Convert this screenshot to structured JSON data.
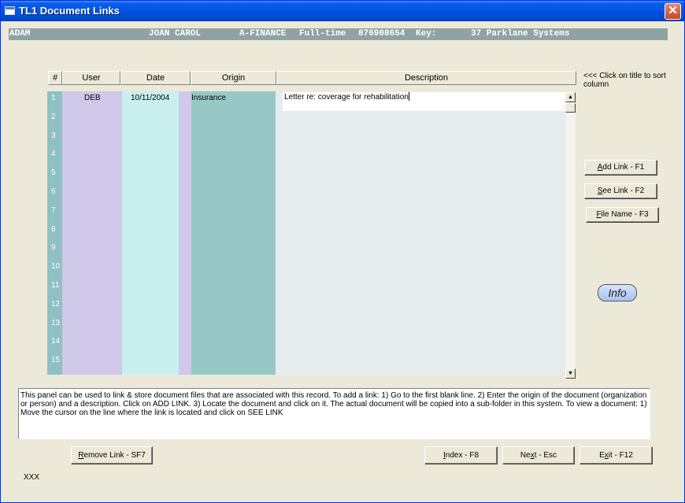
{
  "window": {
    "title": "TL1 Document Links",
    "close_glyph": "✕"
  },
  "infobar": {
    "name_code": "ADAM",
    "person": "JOAN CAROL",
    "dept": "A-FINANCE",
    "status": "Full-time",
    "id": "876908654",
    "key_label": "Key:",
    "key_value": "37 Parklane Systems"
  },
  "grid": {
    "headers": {
      "num": "#",
      "user": "User",
      "date": "Date",
      "origin": "Origin",
      "description": "Description"
    },
    "row_numbers": [
      "1",
      "2",
      "3",
      "4",
      "5",
      "6",
      "7",
      "8",
      "9",
      "10",
      "11",
      "12",
      "13",
      "14",
      "15"
    ],
    "rows": [
      {
        "user": "DEB",
        "date": "10/11/2004",
        "origin": "Insurance",
        "description": "Letter re: coverage for rehabilitation"
      }
    ]
  },
  "sort_hint": "<<< Click on title to sort column",
  "buttons": {
    "add_link": {
      "hot": "A",
      "rest": "dd Link - F1"
    },
    "see_link": {
      "hot": "S",
      "rest": "ee Link - F2"
    },
    "file_name": {
      "hot": "F",
      "rest": "ile Name - F3"
    },
    "info": "Info",
    "remove_link": {
      "hot": "R",
      "rest": "emove Link - SF7"
    },
    "index": {
      "hot": "I",
      "rest": "ndex - F8"
    },
    "next": {
      "pre": "Ne",
      "hot": "x",
      "rest": "t - Esc"
    },
    "exit": {
      "pre": "E",
      "hot": "x",
      "rest": "it - F12"
    }
  },
  "help_text": "This panel can be used to link & store document files that are associated with this record.        To add a link: 1) Go to the first blank line. 2) Enter the origin of the document (organization or person) and a description. Click on ADD LINK. 3) Locate the document and click on it. The actual document will be copied into a sub-folder in this system.        To view a document: 1) Move the cursor on the line where the link is located and click on SEE LINK",
  "footer": "XXX",
  "colors": {
    "num_col": "#8FC0C4",
    "user_col": "#D0C8E8",
    "date_col": "#C9F0EF",
    "gap_col": "#D0C8E8",
    "origin_col": "#98C8C5",
    "desc_col": "#E4ECEE"
  }
}
